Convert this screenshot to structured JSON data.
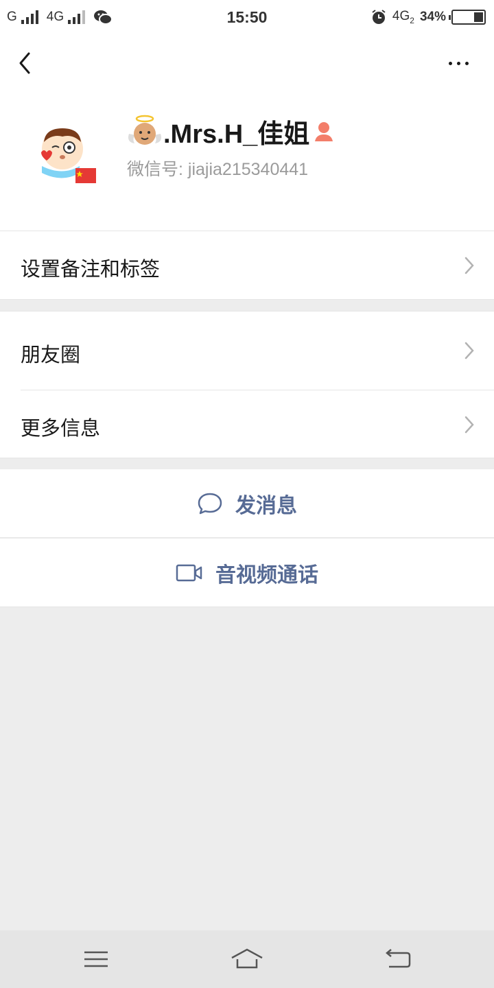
{
  "status_bar": {
    "carrier1": "G",
    "carrier2": "4G",
    "time": "15:50",
    "net": "4G",
    "net_sub": "2",
    "battery": "34%"
  },
  "profile": {
    "name": ".Mrs.H_佳姐",
    "wechat_id_label": "微信号:",
    "wechat_id": "jiajia215340441"
  },
  "menu": {
    "remarks_label": "设置备注和标签",
    "moments_label": "朋友圈",
    "more_info_label": "更多信息"
  },
  "actions": {
    "message_label": "发消息",
    "video_call_label": "音视频通话"
  },
  "colors": {
    "accent": "#576b95",
    "background": "#ededed",
    "text_secondary": "#9b9b9b"
  },
  "icons": {
    "back": "chevron-left-icon",
    "more": "more-dots-icon",
    "message": "chat-bubble-icon",
    "video": "video-camera-icon"
  }
}
